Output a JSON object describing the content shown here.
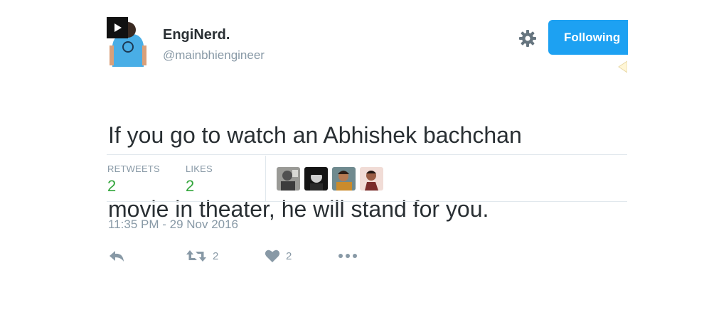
{
  "user": {
    "display_name": "EngiNerd.",
    "handle": "@mainbhiengineer"
  },
  "follow_button": {
    "label": "Following"
  },
  "tweet": {
    "text_line1": "If you go to watch an Abhishek bachchan",
    "text_line2": "movie in theater, he will stand for you."
  },
  "stats": {
    "retweets_label": "RETWEETS",
    "retweets_value": "2",
    "likes_label": "LIKES",
    "likes_value": "2"
  },
  "timestamp": "11:35 PM - 29 Nov 2016",
  "actions": {
    "retweet_count": "2",
    "like_count": "2"
  },
  "colors": {
    "accent": "#1da1f2",
    "stat_value": "#33a63c",
    "muted": "#8899a6",
    "text": "#292f33",
    "divider": "#e1e8ed"
  },
  "icons": [
    "play-icon",
    "gear-icon",
    "reply-icon",
    "retweet-icon",
    "heart-icon",
    "more-icon"
  ]
}
